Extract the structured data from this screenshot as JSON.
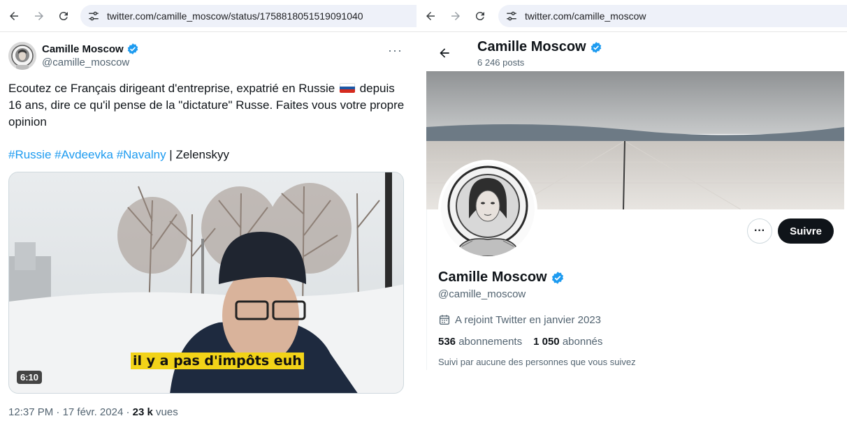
{
  "left": {
    "url": "twitter.com/camille_moscow/status/1758818051519091040",
    "tweet": {
      "author_name": "Camille Moscow",
      "author_handle": "@camille_moscow",
      "text_before_flag": "Ecoutez ce Français dirigeant d'entreprise, expatrié en Russie ",
      "text_after_flag": " depuis 16 ans, dire ce qu'il pense de la \"dictature\" Russe. Faites vous votre propre opinion",
      "hashtags": [
        "#Russie",
        "#Avdeevka",
        "#Navalny"
      ],
      "separator": " | ",
      "trailing_text": "Zelenskyy",
      "video": {
        "subtitle": "il y a pas d'impôts euh",
        "duration": "6:10"
      },
      "time": "12:37 PM",
      "date": "17 févr. 2024",
      "dot": " · ",
      "views_count": "23 k",
      "views_label": " vues"
    }
  },
  "right": {
    "url": "twitter.com/camille_moscow",
    "profile": {
      "name": "Camille Moscow",
      "posts_count": "6 246 posts",
      "handle": "@camille_moscow",
      "follow_label": "Suivre",
      "more_label": "···",
      "joined": "A rejoint Twitter en janvier 2023",
      "following_count": "536",
      "following_label": " abonnements",
      "followers_count": "1 050",
      "followers_label": " abonnés",
      "followed_by": "Suivi par aucune des personnes que vous suivez"
    }
  },
  "colors": {
    "verified": "#1d9bf0",
    "link": "#1d9bf0",
    "subtitle_bg": "#f2d318",
    "follow_bg": "#0f1419"
  }
}
